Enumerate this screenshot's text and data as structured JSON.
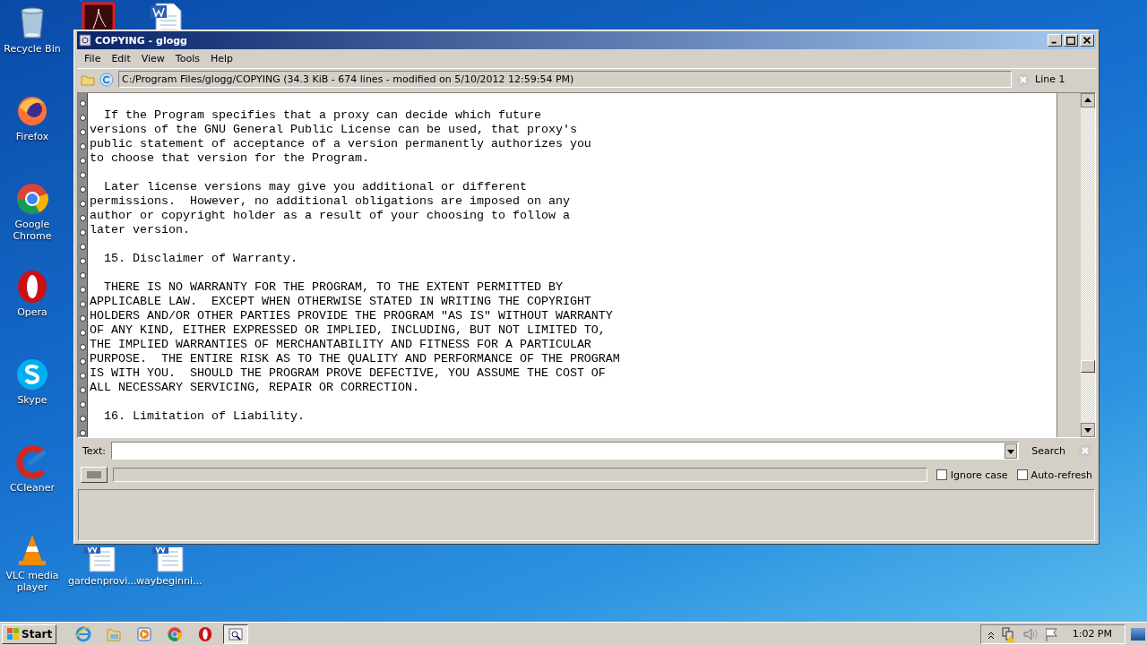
{
  "desktop_icons": [
    {
      "kind": "bin",
      "label": "Recycle Bin"
    },
    {
      "kind": "firefox",
      "label": "Firefox"
    },
    {
      "kind": "chrome",
      "label": "Google Chrome"
    },
    {
      "kind": "opera",
      "label": "Opera"
    },
    {
      "kind": "skype",
      "label": "Skype"
    },
    {
      "kind": "ccleaner",
      "label": "CCleaner"
    },
    {
      "kind": "vlc",
      "label": "VLC media player"
    },
    {
      "kind": "pdf"
    },
    {
      "kind": "word"
    },
    {
      "kind": "word",
      "label": "gardenprovi..."
    },
    {
      "kind": "word",
      "label": "waybeginni..."
    }
  ],
  "window": {
    "title": "COPYING - glogg",
    "menu": [
      "File",
      "Edit",
      "View",
      "Tools",
      "Help"
    ],
    "file_info": "C:/Program Files/glogg/COPYING (34.3 KiB - 674 lines - modified on 5/10/2012 12:59:54 PM)",
    "line_label": "Line 1",
    "paragraphs": [
      [
        "  If the Program specifies that a proxy can decide which future",
        "versions of the GNU General Public License can be used, that proxy's",
        "public statement of acceptance of a version permanently authorizes you",
        "to choose that version for the Program."
      ],
      [
        "  Later license versions may give you additional or different",
        "permissions.  However, no additional obligations are imposed on any",
        "author or copyright holder as a result of your choosing to follow a",
        "later version."
      ],
      [
        "  15. Disclaimer of Warranty."
      ],
      [
        "  THERE IS NO WARRANTY FOR THE PROGRAM, TO THE EXTENT PERMITTED BY",
        "APPLICABLE LAW.  EXCEPT WHEN OTHERWISE STATED IN WRITING THE COPYRIGHT",
        "HOLDERS AND/OR OTHER PARTIES PROVIDE THE PROGRAM \"AS IS\" WITHOUT WARRANTY",
        "OF ANY KIND, EITHER EXPRESSED OR IMPLIED, INCLUDING, BUT NOT LIMITED TO,",
        "THE IMPLIED WARRANTIES OF MERCHANTABILITY AND FITNESS FOR A PARTICULAR",
        "PURPOSE.  THE ENTIRE RISK AS TO THE QUALITY AND PERFORMANCE OF THE PROGRAM",
        "IS WITH YOU.  SHOULD THE PROGRAM PROVE DEFECTIVE, YOU ASSUME THE COST OF",
        "ALL NECESSARY SERVICING, REPAIR OR CORRECTION."
      ],
      [
        "  16. Limitation of Liability."
      ]
    ],
    "progress": {
      "level": 0
    },
    "search": {
      "label": "Text:",
      "button": "Search"
    },
    "options": [
      {
        "label": "Ignore case",
        "checked": false
      },
      {
        "label": "Auto-refresh",
        "checked": false
      }
    ]
  },
  "taskbar": {
    "start": "Start",
    "apps": [
      {
        "kind": "ie",
        "selected": false
      },
      {
        "kind": "folder",
        "selected": false
      },
      {
        "kind": "media",
        "selected": false
      },
      {
        "kind": "chrome",
        "selected": false
      },
      {
        "kind": "opera",
        "selected": false
      },
      {
        "kind": "glogg",
        "selected": true
      }
    ],
    "clock": "1:02 PM"
  }
}
